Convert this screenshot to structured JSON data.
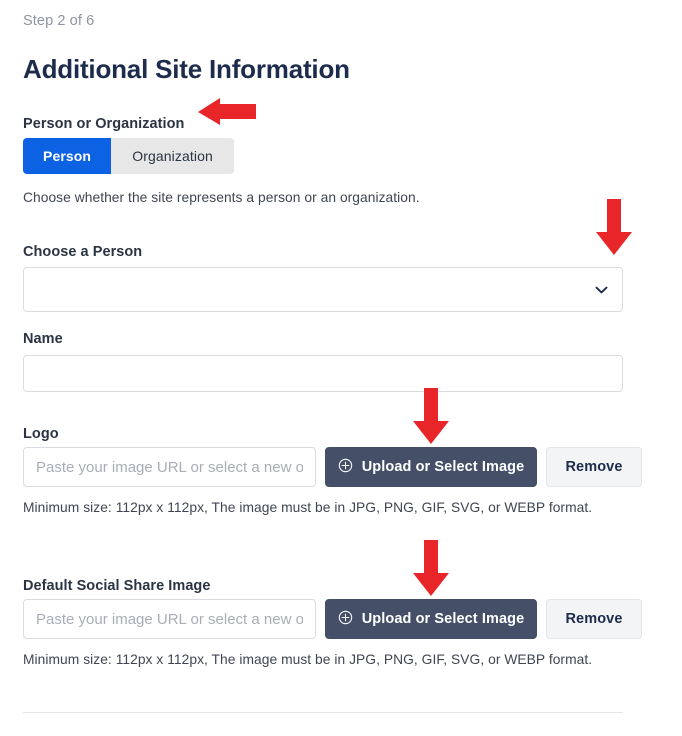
{
  "wizard": {
    "step_text": "Step 2 of 6",
    "title": "Additional Site Information"
  },
  "colors": {
    "primary": "#0d62e3",
    "dark_button": "#454f68",
    "heading": "#1d2b4c",
    "muted_text": "#8d95a0",
    "annotation_red": "#e8262a"
  },
  "person_or_organization": {
    "label": "Person or Organization",
    "options": [
      {
        "label": "Person",
        "selected": true
      },
      {
        "label": "Organization",
        "selected": false
      }
    ],
    "help": "Choose whether the site represents a person or an organization."
  },
  "choose_person": {
    "label": "Choose a Person",
    "value": "",
    "options": [
      ""
    ],
    "icon": "chevron-down-icon"
  },
  "name": {
    "label": "Name",
    "value": "",
    "placeholder": ""
  },
  "logo": {
    "label": "Logo",
    "value": "",
    "placeholder": "Paste your image URL or select a new one",
    "upload_label": "Upload or Select Image",
    "upload_icon": "plus-circle-icon",
    "remove_label": "Remove",
    "help": "Minimum size: 112px x 112px, The image must be in JPG, PNG, GIF, SVG, or WEBP format."
  },
  "social_share": {
    "label": "Default Social Share Image",
    "value": "",
    "placeholder": "Paste your image URL or select a new one",
    "upload_label": "Upload or Select Image",
    "upload_icon": "plus-circle-icon",
    "remove_label": "Remove",
    "help": "Minimum size: 112px x 112px, The image must be in JPG, PNG, GIF, SVG, or WEBP format."
  },
  "annotations": [
    {
      "name": "arrow-person-org-label",
      "direction": "left"
    },
    {
      "name": "arrow-choose-person-select",
      "direction": "down"
    },
    {
      "name": "arrow-logo-upload-button",
      "direction": "down"
    },
    {
      "name": "arrow-social-upload-button",
      "direction": "down"
    }
  ]
}
